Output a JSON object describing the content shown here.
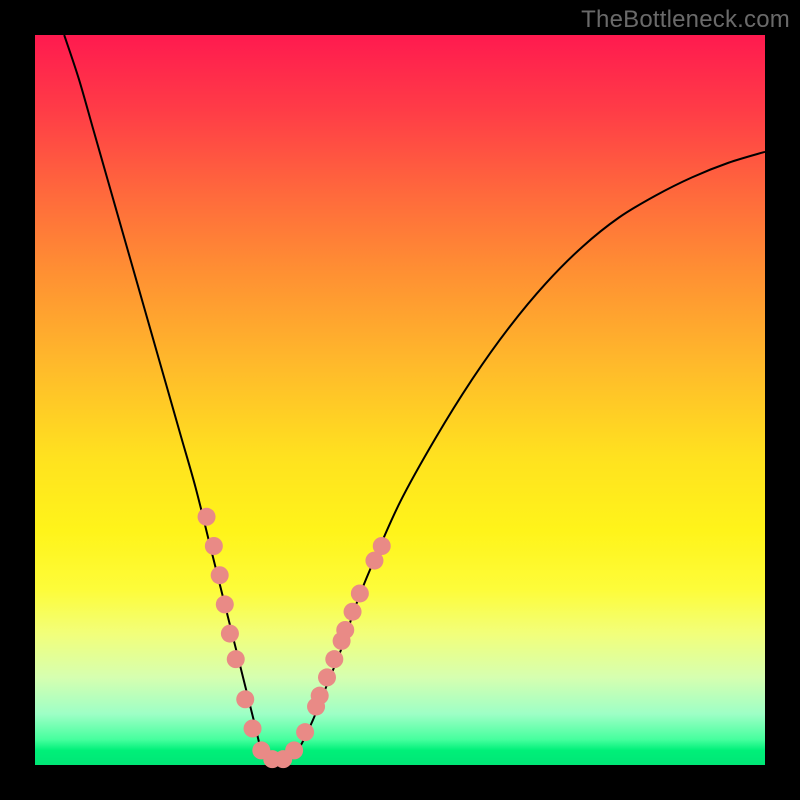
{
  "watermark": "TheBottleneck.com",
  "chart_data": {
    "type": "line",
    "title": "",
    "xlabel": "",
    "ylabel": "",
    "xlim": [
      0,
      100
    ],
    "ylim": [
      0,
      100
    ],
    "background_gradient": {
      "direction": "vertical",
      "stops": [
        {
          "pos": 0.0,
          "color": "#ff1a4f"
        },
        {
          "pos": 0.1,
          "color": "#ff3b47"
        },
        {
          "pos": 0.22,
          "color": "#ff6a3c"
        },
        {
          "pos": 0.32,
          "color": "#ff8e33"
        },
        {
          "pos": 0.45,
          "color": "#ffb92b"
        },
        {
          "pos": 0.58,
          "color": "#ffe21f"
        },
        {
          "pos": 0.68,
          "color": "#fff41a"
        },
        {
          "pos": 0.76,
          "color": "#fdfc3a"
        },
        {
          "pos": 0.82,
          "color": "#f2ff7a"
        },
        {
          "pos": 0.88,
          "color": "#d6ffb0"
        },
        {
          "pos": 0.93,
          "color": "#9effc6"
        },
        {
          "pos": 0.965,
          "color": "#46ff9e"
        },
        {
          "pos": 0.98,
          "color": "#00f079"
        },
        {
          "pos": 1.0,
          "color": "#00e676"
        }
      ]
    },
    "series": [
      {
        "name": "bottleneck-curve",
        "color": "#000000",
        "x": [
          4,
          6,
          8,
          10,
          12,
          14,
          16,
          18,
          20,
          22,
          24,
          26,
          28,
          30,
          31,
          32,
          34,
          36,
          38,
          40,
          42,
          44,
          46,
          50,
          55,
          60,
          65,
          70,
          75,
          80,
          85,
          90,
          95,
          100
        ],
        "y": [
          100,
          94,
          87,
          80,
          73,
          66,
          59,
          52,
          45,
          38,
          30,
          22,
          14,
          6,
          2,
          0,
          0,
          2,
          6,
          11,
          16,
          22,
          27,
          36,
          45,
          53,
          60,
          66,
          71,
          75,
          78,
          80.5,
          82.5,
          84
        ]
      }
    ],
    "markers": {
      "name": "highlighted-points",
      "color": "#e98a86",
      "radius": 9,
      "points": [
        {
          "x": 23.5,
          "y": 34
        },
        {
          "x": 24.5,
          "y": 30
        },
        {
          "x": 25.3,
          "y": 26
        },
        {
          "x": 26.0,
          "y": 22
        },
        {
          "x": 26.7,
          "y": 18
        },
        {
          "x": 27.5,
          "y": 14.5
        },
        {
          "x": 28.8,
          "y": 9
        },
        {
          "x": 29.8,
          "y": 5
        },
        {
          "x": 31.0,
          "y": 2
        },
        {
          "x": 32.5,
          "y": 0.8
        },
        {
          "x": 34.0,
          "y": 0.8
        },
        {
          "x": 35.5,
          "y": 2
        },
        {
          "x": 37.0,
          "y": 4.5
        },
        {
          "x": 38.5,
          "y": 8
        },
        {
          "x": 39.0,
          "y": 9.5
        },
        {
          "x": 40.0,
          "y": 12
        },
        {
          "x": 41.0,
          "y": 14.5
        },
        {
          "x": 42.0,
          "y": 17
        },
        {
          "x": 42.5,
          "y": 18.5
        },
        {
          "x": 43.5,
          "y": 21
        },
        {
          "x": 44.5,
          "y": 23.5
        },
        {
          "x": 46.5,
          "y": 28
        },
        {
          "x": 47.5,
          "y": 30
        }
      ]
    }
  }
}
